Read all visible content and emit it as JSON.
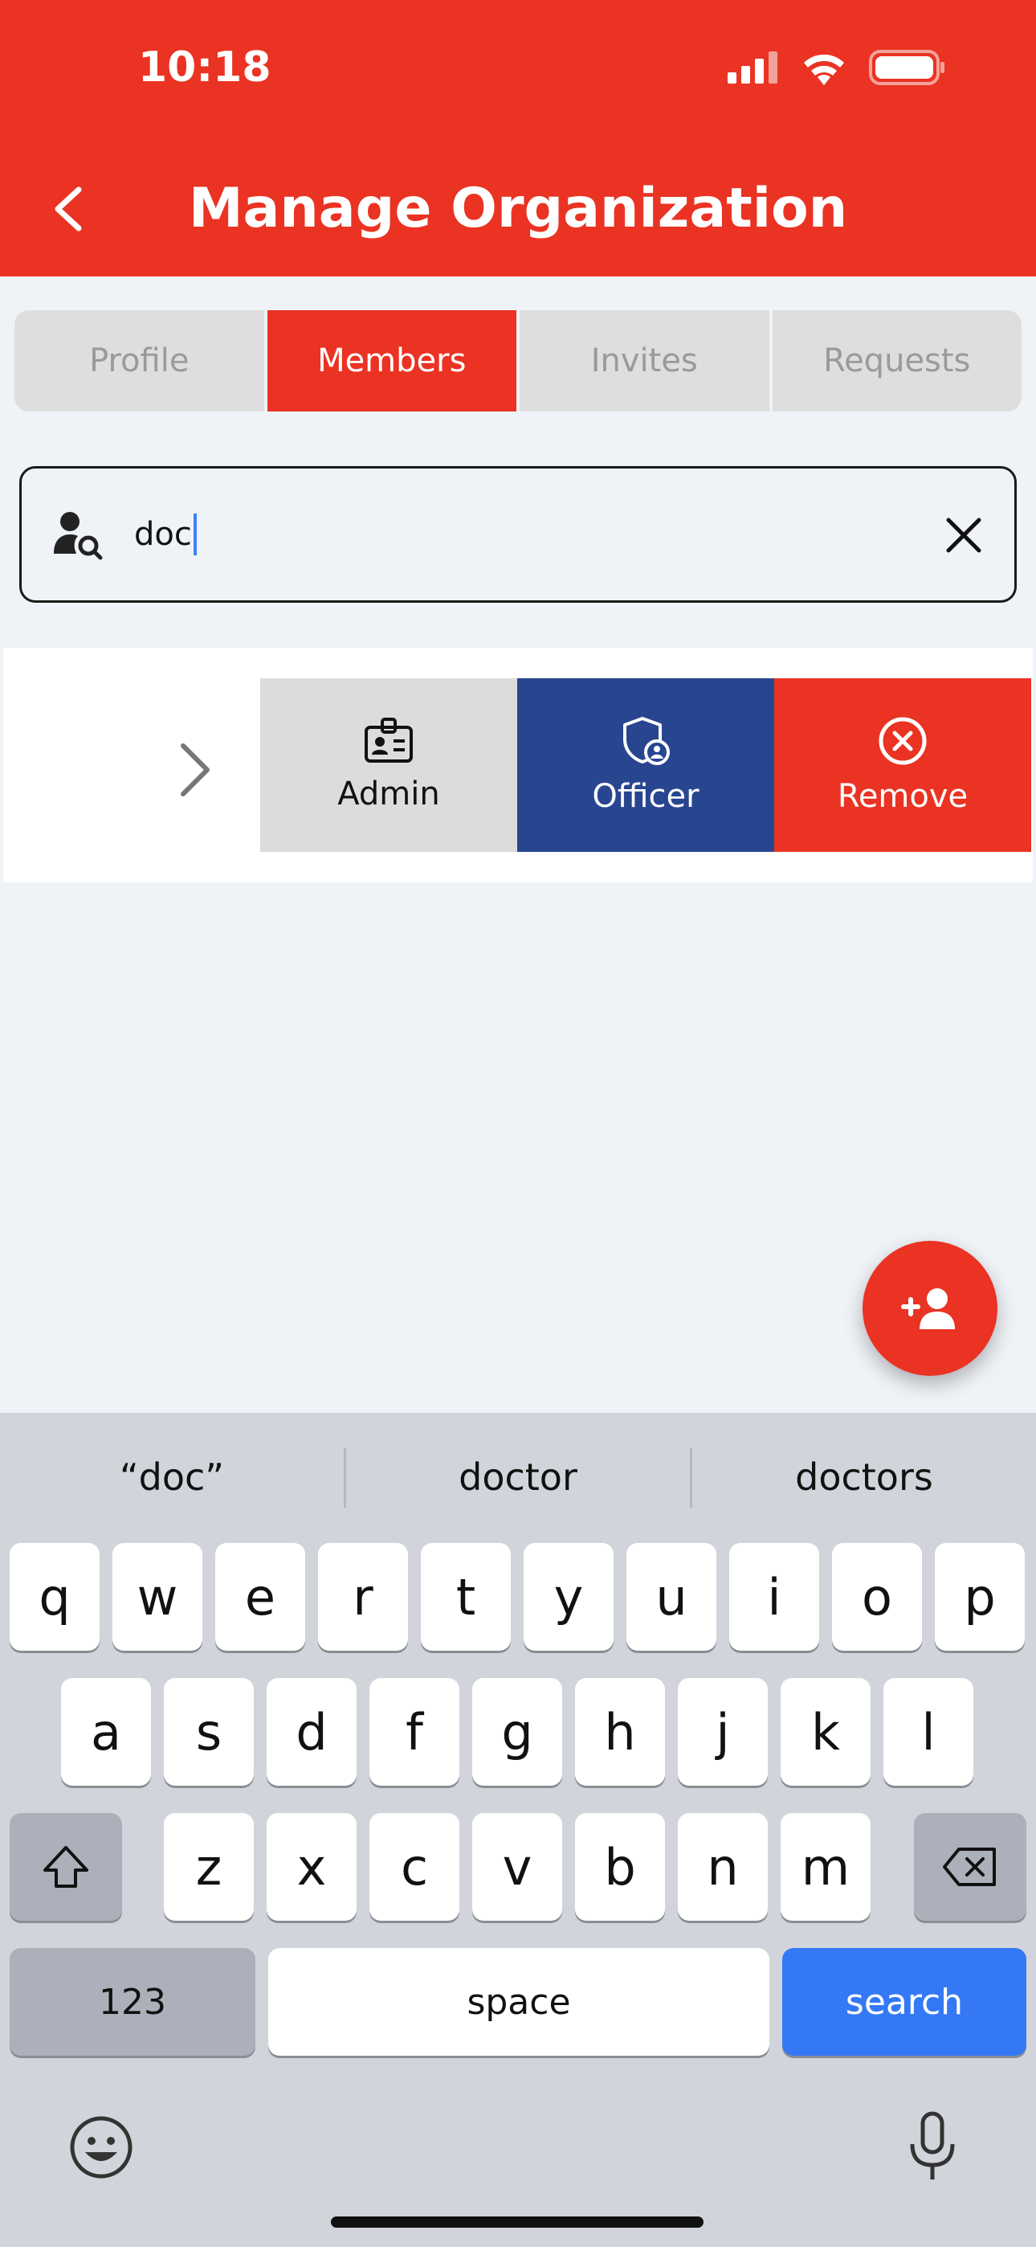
{
  "status_bar": {
    "time": "10:18"
  },
  "header": {
    "title": "Manage Organization"
  },
  "tabs": [
    {
      "label": "Profile",
      "active": false
    },
    {
      "label": "Members",
      "active": true
    },
    {
      "label": "Invites",
      "active": false
    },
    {
      "label": "Requests",
      "active": false
    }
  ],
  "search": {
    "value": "doc"
  },
  "member_actions": {
    "admin": "Admin",
    "officer": "Officer",
    "remove": "Remove"
  },
  "keyboard": {
    "suggestions": [
      "“doc”",
      "doctor",
      "doctors"
    ],
    "row1": [
      "q",
      "w",
      "e",
      "r",
      "t",
      "y",
      "u",
      "i",
      "o",
      "p"
    ],
    "row2": [
      "a",
      "s",
      "d",
      "f",
      "g",
      "h",
      "j",
      "k",
      "l"
    ],
    "row3": [
      "z",
      "x",
      "c",
      "v",
      "b",
      "n",
      "m"
    ],
    "numbers_label": "123",
    "space_label": "space",
    "search_label": "search"
  },
  "colors": {
    "brand_red": "#ea3323",
    "officer_blue": "#284590",
    "keyboard_blue": "#3478f6"
  }
}
